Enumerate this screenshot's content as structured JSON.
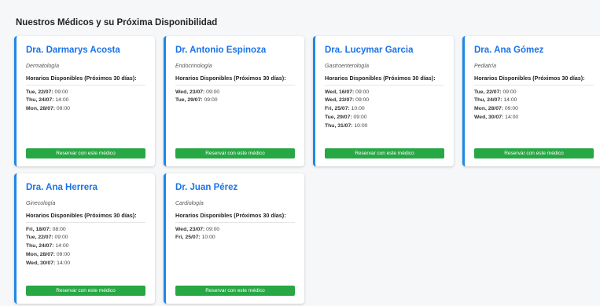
{
  "page": {
    "title": "Nuestros Médicos y su Próxima Disponibilidad"
  },
  "slots_heading": "Horarios Disponibles (Próximos 30 días):",
  "book_button_label": "Reservar con este médico",
  "colors": {
    "accent": "#1e88e5",
    "doctor_name": "#1a73e8",
    "book_button": "#28a745"
  },
  "doctors": [
    {
      "name": "Dra. Darmarys Acosta",
      "specialty": "Dermatología",
      "slots": [
        {
          "day": "Tue, 22/07:",
          "time": "09:00"
        },
        {
          "day": "Thu, 24/07:",
          "time": "14:00"
        },
        {
          "day": "Mon, 28/07:",
          "time": "09:00"
        }
      ]
    },
    {
      "name": "Dr. Antonio Espinoza",
      "specialty": "Endocrinología",
      "slots": [
        {
          "day": "Wed, 23/07:",
          "time": "09:00"
        },
        {
          "day": "Tue, 29/07:",
          "time": "09:00"
        }
      ]
    },
    {
      "name": "Dra. Lucymar Garcia",
      "specialty": "Gastroenterología",
      "slots": [
        {
          "day": "Wed, 16/07:",
          "time": "09:00"
        },
        {
          "day": "Wed, 23/07:",
          "time": "09:00"
        },
        {
          "day": "Fri, 25/07:",
          "time": "10:00"
        },
        {
          "day": "Tue, 29/07:",
          "time": "09:00"
        },
        {
          "day": "Thu, 31/07:",
          "time": "10:00"
        }
      ]
    },
    {
      "name": "Dra. Ana Gómez",
      "specialty": "Pediatría",
      "slots": [
        {
          "day": "Tue, 22/07:",
          "time": "09:00"
        },
        {
          "day": "Thu, 24/07:",
          "time": "14:00"
        },
        {
          "day": "Mon, 28/07:",
          "time": "09:00"
        },
        {
          "day": "Wed, 30/07:",
          "time": "14:00"
        }
      ]
    },
    {
      "name": "Dra. Ana Herrera",
      "specialty": "Ginecología",
      "slots": [
        {
          "day": "Fri, 18/07:",
          "time": "08:00"
        },
        {
          "day": "Tue, 22/07:",
          "time": "09:00"
        },
        {
          "day": "Thu, 24/07:",
          "time": "14:00"
        },
        {
          "day": "Mon, 28/07:",
          "time": "09:00"
        },
        {
          "day": "Wed, 30/07:",
          "time": "14:00"
        }
      ]
    },
    {
      "name": "Dr. Juan Pérez",
      "specialty": "Cardiología",
      "slots": [
        {
          "day": "Wed, 23/07:",
          "time": "09:00"
        },
        {
          "day": "Fri, 25/07:",
          "time": "10:00"
        }
      ]
    }
  ]
}
